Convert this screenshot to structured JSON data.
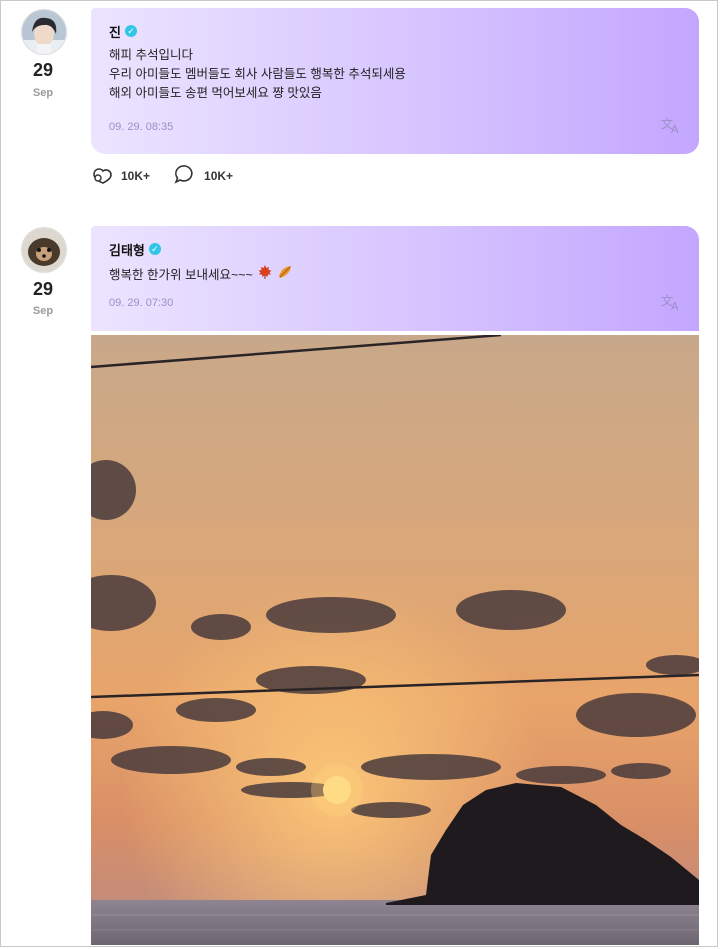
{
  "posts": [
    {
      "author": "진",
      "date_day": "29",
      "date_month": "Sep",
      "lines": [
        "해피 추석입니다",
        "우리 아미들도 멤버들도 회사 사람들도 행복한 추석되세용",
        "해외 아미들도 송편 먹어보세요 쨩 맛있음"
      ],
      "timestamp": "09. 29. 08:35",
      "likes": "10K+",
      "comments": "10K+"
    },
    {
      "author": "김태형",
      "date_day": "29",
      "date_month": "Sep",
      "text": "행복한 한가위 보내세요~~~",
      "timestamp": "09. 29. 07:30"
    }
  ],
  "icons": {
    "verified": "verified-badge-icon",
    "translate": "translate-icon",
    "like": "like-icon",
    "comment": "comment-icon",
    "emoji_leaf": "maple-leaf-icon",
    "emoji_fallen": "fallen-leaf-icon"
  },
  "colors": {
    "bubble_start": "#ece4ff",
    "bubble_end": "#c4a6ff",
    "verified": "#31c6e8"
  }
}
